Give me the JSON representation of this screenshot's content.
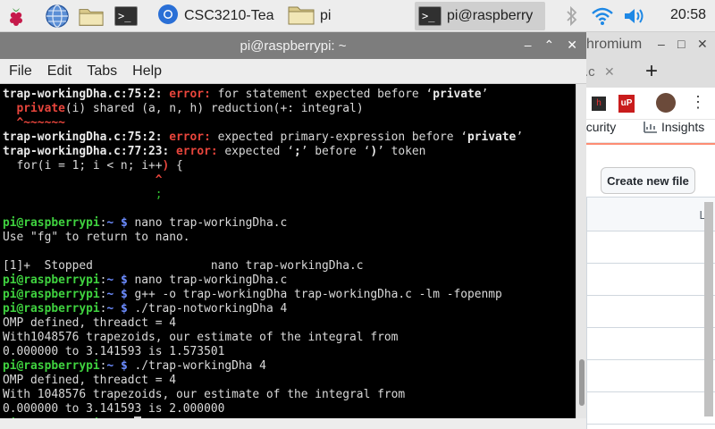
{
  "taskbar": {
    "tasks": [
      {
        "label": "CSC3210-Tea",
        "active": false
      },
      {
        "label": "pi",
        "active": false
      },
      {
        "label": "pi@raspberry",
        "active": true
      }
    ],
    "clock": "20:58"
  },
  "terminal": {
    "title": "pi@raspberrypi: ~",
    "menu": [
      "File",
      "Edit",
      "Tabs",
      "Help"
    ],
    "prompt": {
      "user": "pi@raspberrypi",
      "sep": ":",
      "path": "~",
      "dollar": "$"
    },
    "lines": [
      {
        "parts": [
          {
            "t": "trap-workingDha.c:75:2: ",
            "c": "b"
          },
          {
            "t": "error: ",
            "c": "err"
          },
          {
            "t": "for statement expected before ‘",
            "c": ""
          },
          {
            "t": "private",
            "c": "b"
          },
          {
            "t": "’",
            "c": ""
          }
        ]
      },
      {
        "parts": [
          {
            "t": "  ",
            "c": ""
          },
          {
            "t": "private",
            "c": "red"
          },
          {
            "t": "(i) shared (a, n, h) reduction(+: integral)",
            "c": ""
          }
        ]
      },
      {
        "parts": [
          {
            "t": "  ^~~~~~~",
            "c": "red"
          }
        ]
      },
      {
        "parts": [
          {
            "t": "trap-workingDha.c:75:2: ",
            "c": "b"
          },
          {
            "t": "error: ",
            "c": "err"
          },
          {
            "t": "expected primary-expression before ‘",
            "c": ""
          },
          {
            "t": "private",
            "c": "b"
          },
          {
            "t": "’",
            "c": ""
          }
        ]
      },
      {
        "parts": [
          {
            "t": "trap-workingDha.c:77:23: ",
            "c": "b"
          },
          {
            "t": "error: ",
            "c": "err"
          },
          {
            "t": "expected ‘",
            "c": ""
          },
          {
            "t": ";",
            "c": "b"
          },
          {
            "t": "’ before ‘",
            "c": ""
          },
          {
            "t": ")",
            "c": "b"
          },
          {
            "t": "’ token",
            "c": ""
          }
        ]
      },
      {
        "parts": [
          {
            "t": "  for(i = 1; i < n; i++",
            "c": ""
          },
          {
            "t": ")",
            "c": "red"
          },
          {
            "t": " {",
            "c": ""
          }
        ]
      },
      {
        "parts": [
          {
            "t": "                      ^",
            "c": "red"
          }
        ]
      },
      {
        "parts": [
          {
            "t": "                      ;",
            "c": "grn"
          }
        ]
      },
      {
        "parts": [
          {
            "t": "",
            "c": ""
          }
        ]
      },
      {
        "prompt": true,
        "cmd": "nano trap-workingDha.c"
      },
      {
        "parts": [
          {
            "t": "Use \"fg\" to return to nano.",
            "c": ""
          }
        ]
      },
      {
        "parts": [
          {
            "t": "",
            "c": ""
          }
        ]
      },
      {
        "parts": [
          {
            "t": "[1]+  Stopped                 nano trap-workingDha.c",
            "c": ""
          }
        ]
      },
      {
        "prompt": true,
        "cmd": "nano trap-workingDha.c"
      },
      {
        "prompt": true,
        "cmd": "g++ -o trap-workingDha trap-workingDha.c -lm -fopenmp"
      },
      {
        "prompt": true,
        "cmd": "./trap-notworkingDha 4"
      },
      {
        "parts": [
          {
            "t": "OMP defined, threadct = 4",
            "c": ""
          }
        ]
      },
      {
        "parts": [
          {
            "t": "With1048576 trapezoids, our estimate of the integral from",
            "c": ""
          }
        ]
      },
      {
        "parts": [
          {
            "t": "0.000000 to 3.141593 is 1.573501",
            "c": ""
          }
        ]
      },
      {
        "prompt": true,
        "cmd": "./trap-workingDha 4"
      },
      {
        "parts": [
          {
            "t": "OMP defined, threadct = 4",
            "c": ""
          }
        ]
      },
      {
        "parts": [
          {
            "t": "With 1048576 trapezoids, our estimate of the integral from",
            "c": ""
          }
        ]
      },
      {
        "parts": [
          {
            "t": "0.000000 to 3.141593 is 2.000000",
            "c": ""
          }
        ]
      },
      {
        "prompt": true,
        "cmd": "",
        "cursor": true
      }
    ]
  },
  "chromium": {
    "title_fragment": "hromium",
    "tab_fragment": ".c",
    "ext_label": "7",
    "ext2_label": "uP",
    "nav_security": "ecurity",
    "nav_insights": "Insights",
    "create_new_file": "Create new file",
    "header_fragment": "La"
  },
  "colors": {
    "prompt_user": "#3fd23f",
    "prompt_path": "#6c8cff",
    "error": "#e8453c"
  }
}
